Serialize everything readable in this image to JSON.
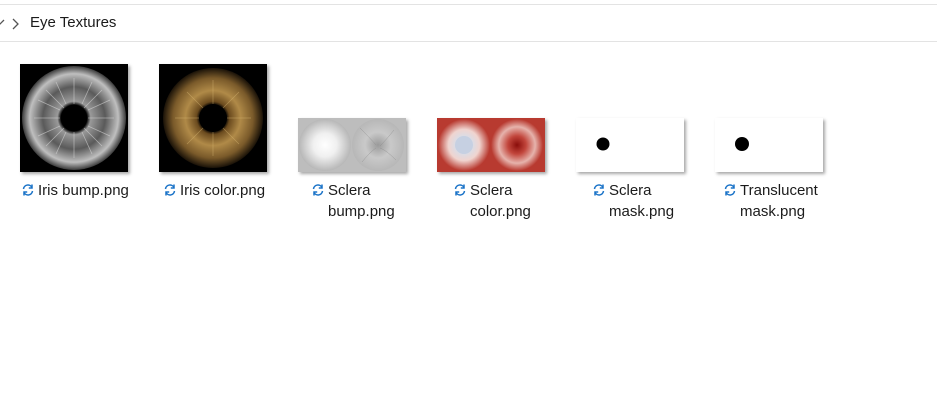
{
  "window": {
    "breadcrumb": {
      "current": "Eye Textures"
    }
  },
  "files": [
    {
      "name_line1": "Iris bump.png",
      "name_line2": "",
      "thumb_icon": "iris-bump-thumbnail",
      "sync_icon": "sync-icon"
    },
    {
      "name_line1": "Iris color.png",
      "name_line2": "",
      "thumb_icon": "iris-color-thumbnail",
      "sync_icon": "sync-icon"
    },
    {
      "name_line1": "Sclera",
      "name_line2": "bump.png",
      "thumb_icon": "sclera-bump-thumbnail",
      "sync_icon": "sync-icon"
    },
    {
      "name_line1": "Sclera",
      "name_line2": "color.png",
      "thumb_icon": "sclera-color-thumbnail",
      "sync_icon": "sync-icon"
    },
    {
      "name_line1": "Sclera",
      "name_line2": "mask.png",
      "thumb_icon": "sclera-mask-thumbnail",
      "sync_icon": "sync-icon"
    },
    {
      "name_line1": "Translucent",
      "name_line2": "mask.png",
      "thumb_icon": "translucent-mask-thumbnail",
      "sync_icon": "sync-icon"
    }
  ],
  "colors": {
    "sync_blue": "#1a73c8",
    "sclera_red": "#b83a30",
    "divider": "#e3e3e3"
  }
}
